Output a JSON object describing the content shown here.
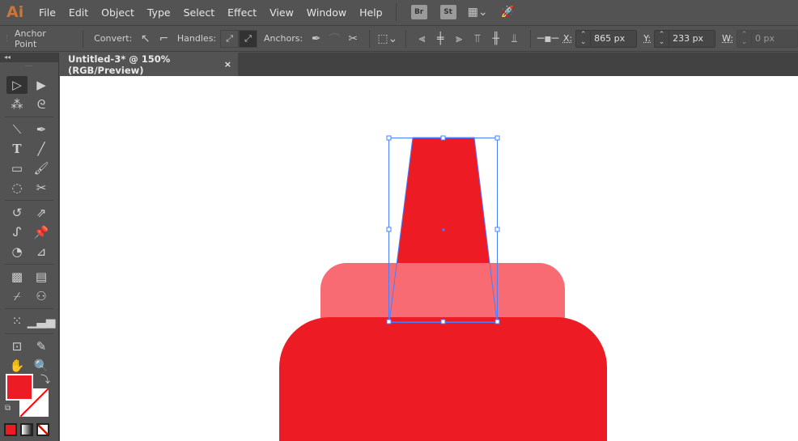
{
  "app": {
    "logo": "Ai",
    "menu": [
      "File",
      "Edit",
      "Object",
      "Type",
      "Select",
      "Effect",
      "View",
      "Window",
      "Help"
    ],
    "bridge": "Br",
    "stock": "St"
  },
  "control": {
    "tool_name": "Anchor Point",
    "convert_label": "Convert:",
    "handles_label": "Handles:",
    "anchors_label": "Anchors:",
    "x_label": "X:",
    "x_value": "865 px",
    "y_label": "Y:",
    "y_value": "233 px",
    "w_label": "W:",
    "w_value": "0 px"
  },
  "document": {
    "tab_title": "Untitled-3* @ 150% (RGB/Preview)",
    "close": "×"
  },
  "colors": {
    "fill": "#ed1c24",
    "cap": "#f86b73",
    "selection": "#4a7cff"
  }
}
